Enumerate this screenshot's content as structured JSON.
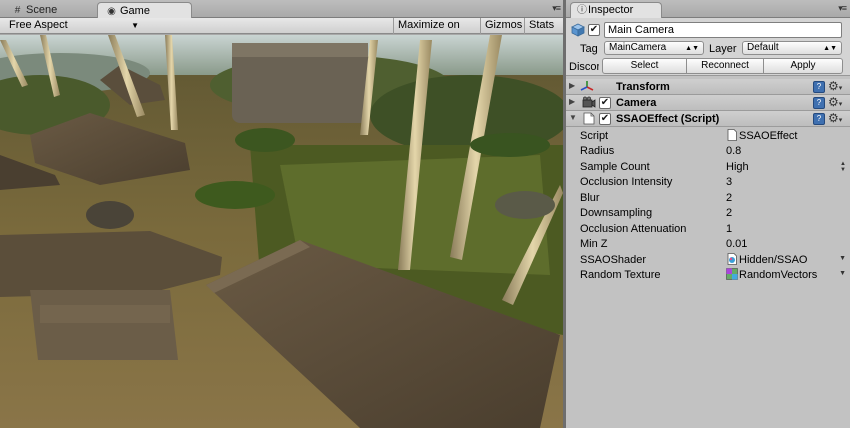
{
  "game_view": {
    "tabs": [
      {
        "label": "Scene",
        "icon": "scene-icon"
      },
      {
        "label": "Game",
        "icon": "game-icon"
      }
    ],
    "aspect": "Free Aspect",
    "toolbar": {
      "maximize_label": "Maximize on Play",
      "gizmos_label": "Gizmos",
      "stats_label": "Stats"
    }
  },
  "inspector": {
    "tab_label": "Inspector",
    "game_object": {
      "name": "Main Camera",
      "tag_label": "Tag",
      "tag_value": "MainCamera",
      "layer_label": "Layer",
      "layer_value": "Default",
      "prefab_label": "Discor",
      "prefab_buttons": {
        "select": "Select",
        "reconnect": "Reconnect",
        "apply": "Apply"
      }
    },
    "components": [
      {
        "title": "Transform",
        "icon": "transform-icon",
        "expanded": false
      },
      {
        "title": "Camera",
        "icon": "camera-icon",
        "expanded": false
      },
      {
        "title": "SSAOEffect (Script)",
        "icon": "script-icon",
        "expanded": true
      }
    ],
    "ssao_properties": [
      {
        "label": "Script",
        "value": "SSAOEffect",
        "icon": "script-file-icon"
      },
      {
        "label": "Radius",
        "value": "0.8"
      },
      {
        "label": "Sample Count",
        "value": "High"
      },
      {
        "label": "Occlusion Intensity",
        "value": "3"
      },
      {
        "label": "Blur",
        "value": "2"
      },
      {
        "label": "Downsampling",
        "value": "2"
      },
      {
        "label": "Occlusion Attenuation",
        "value": "1"
      },
      {
        "label": "Min Z",
        "value": "0.01"
      },
      {
        "label": "SSAOShader",
        "value": "Hidden/SSAO",
        "icon": "shader-icon"
      },
      {
        "label": "Random Texture",
        "value": "RandomVectors",
        "icon": "texture-icon"
      }
    ]
  },
  "colors": {
    "panel_bg": "#c2c2c2",
    "header_bg": "#bdbdbd",
    "accent_blue": "#3f70b0"
  }
}
